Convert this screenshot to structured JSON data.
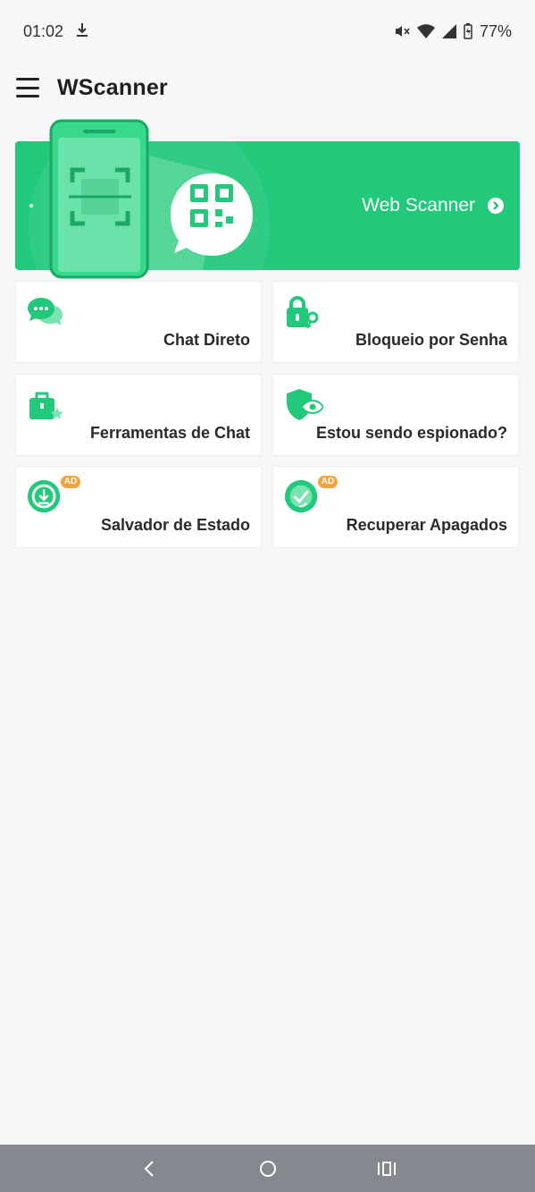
{
  "status_bar": {
    "time": "01:02",
    "battery": "77%"
  },
  "app_bar": {
    "title": "WScanner"
  },
  "banner": {
    "label": "Web Scanner"
  },
  "cards": [
    {
      "label": "Chat Direto",
      "icon": "chat-bubbles-icon",
      "ad": ""
    },
    {
      "label": "Bloqueio por Senha",
      "icon": "lock-key-icon",
      "ad": ""
    },
    {
      "label": "Ferramentas de Chat",
      "icon": "toolbox-icon",
      "ad": ""
    },
    {
      "label": "Estou sendo espionado?",
      "icon": "shield-eye-icon",
      "ad": ""
    },
    {
      "label": "Salvador de Estado",
      "icon": "download-circle-icon",
      "ad": "AD"
    },
    {
      "label": "Recuperar Apagados",
      "icon": "recover-icon",
      "ad": "AD"
    }
  ],
  "colors": {
    "brand": "#22c97a",
    "ad_badge": "#f4a338",
    "background": "#f6f7f9"
  }
}
